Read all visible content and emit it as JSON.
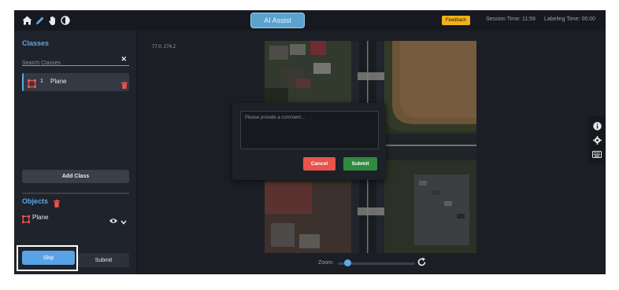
{
  "header": {
    "ai_assist_label": "AI Assist",
    "feedback_label": "Feedback",
    "session_time": "Session Time: 11:59",
    "labeling_time": "Labeling Time: 00:00",
    "icons": [
      "home-icon",
      "pencil-icon",
      "hand-icon",
      "contrast-icon"
    ]
  },
  "sidebar": {
    "classes_title": "Classes",
    "search_placeholder": "Search Classes",
    "classes": [
      {
        "number": "1",
        "name": "Plane",
        "color": "#e8534d"
      }
    ],
    "add_class_label": "Add Class",
    "objects_title": "Objects",
    "objects": [
      {
        "name": "Plane",
        "color": "#e8534d"
      }
    ],
    "skip_label": "Skip",
    "submit_label": "Submit"
  },
  "canvas": {
    "coords": "77.0, 274.2",
    "zoom_label": "Zoom:",
    "zoom_level": 0.08
  },
  "dialog": {
    "comment_placeholder": "Please provide a comment...",
    "cancel_label": "Cancel",
    "submit_label": "Submit"
  },
  "right_tools": [
    "info-icon",
    "settings-icon",
    "keyboard-icon"
  ],
  "colors": {
    "accent": "#5da8e8",
    "danger": "#e8534d",
    "success": "#2e8a3f",
    "feedback": "#f2b01e"
  }
}
